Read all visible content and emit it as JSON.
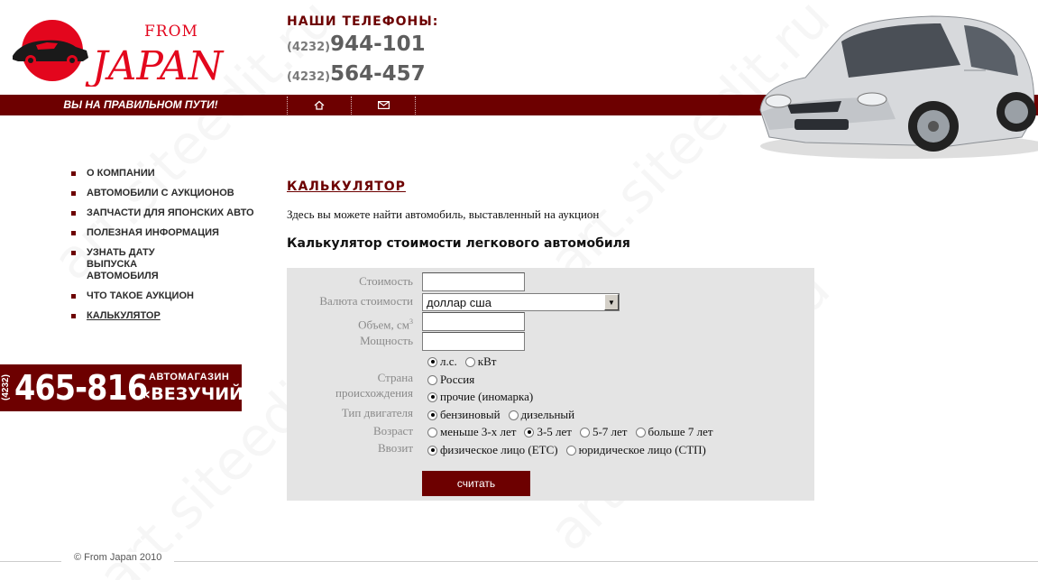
{
  "header": {
    "logo_small": "FROM",
    "logo_big": "JAPAN",
    "phones_title": "НАШИ  ТЕЛЕФОНЫ:",
    "phones": [
      {
        "code": "(4232)",
        "number": "944-101"
      },
      {
        "code": "(4232)",
        "number": "564-457"
      }
    ],
    "slogan": "ВЫ НА ПРАВИЛЬНОМ ПУТИ!",
    "icons": [
      "home-icon",
      "mail-icon"
    ]
  },
  "menu": {
    "items": [
      {
        "label": "О КОМПАНИИ"
      },
      {
        "label": "АВТОМОБИЛИ С АУКЦИОНОВ"
      },
      {
        "label": "ЗАПЧАСТИ ДЛЯ ЯПОНСКИХ АВТО"
      },
      {
        "label": "ПОЛЕЗНАЯ ИНФОРМАЦИЯ"
      },
      {
        "label": "УЗНАТЬ ДАТУ ВЫПУСКА АВТОМОБИЛЯ"
      },
      {
        "label": "ЧТО ТАКОЕ АУКЦИОН"
      },
      {
        "label": "КАЛЬКУЛЯТОР"
      }
    ],
    "active_index": 6
  },
  "banner": {
    "code": "(4232)",
    "number": "465-816",
    "subtitle": "АВТОМАГАЗИН",
    "name": "«ВЕЗУЧИЙ»"
  },
  "main": {
    "title": "КАЛЬКУЛЯТОР",
    "intro": "Здесь вы можете найти автомобиль, выставленный на аукцион",
    "calc_title": "Калькулятор стоимости легкового автомобиля"
  },
  "calculator": {
    "cost_label": "Стоимость",
    "cost_value": "",
    "currency_label": "Валюта стоимости",
    "currency_value": "доллар сша",
    "volume_label": "Объем, см",
    "volume_sup": "3",
    "volume_value": "",
    "power_label": "Мощность",
    "power_value": "",
    "power_units": [
      {
        "label": "л.с.",
        "checked": true
      },
      {
        "label": "кВт",
        "checked": false
      }
    ],
    "country_label_1": "Страна",
    "country_label_2": "происхождения",
    "country_options": [
      {
        "label": "Россия",
        "checked": false
      },
      {
        "label": "прочие (иномарка)",
        "checked": true
      }
    ],
    "engine_label": "Тип двигателя",
    "engine_options": [
      {
        "label": "бензиновый",
        "checked": true
      },
      {
        "label": "дизельный",
        "checked": false
      }
    ],
    "age_label": "Возраст",
    "age_options": [
      {
        "label": "меньше 3-х лет",
        "checked": false
      },
      {
        "label": "3-5 лет",
        "checked": true
      },
      {
        "label": "5-7 лет",
        "checked": false
      },
      {
        "label": "больше 7 лет",
        "checked": false
      }
    ],
    "importer_label": "Ввозит",
    "importer_options": [
      {
        "label": "физическое лицо (ЕТС)",
        "checked": true
      },
      {
        "label": "юридическое лицо (СТП)",
        "checked": false
      }
    ],
    "submit_label": "считать"
  },
  "footer": {
    "copyright": "© From Japan 2010"
  },
  "watermark": "art.siteedit.ru",
  "colors": {
    "brand_red": "#6d0000",
    "panel_gray": "#e4e4e4",
    "logo_red": "#e3061d"
  }
}
